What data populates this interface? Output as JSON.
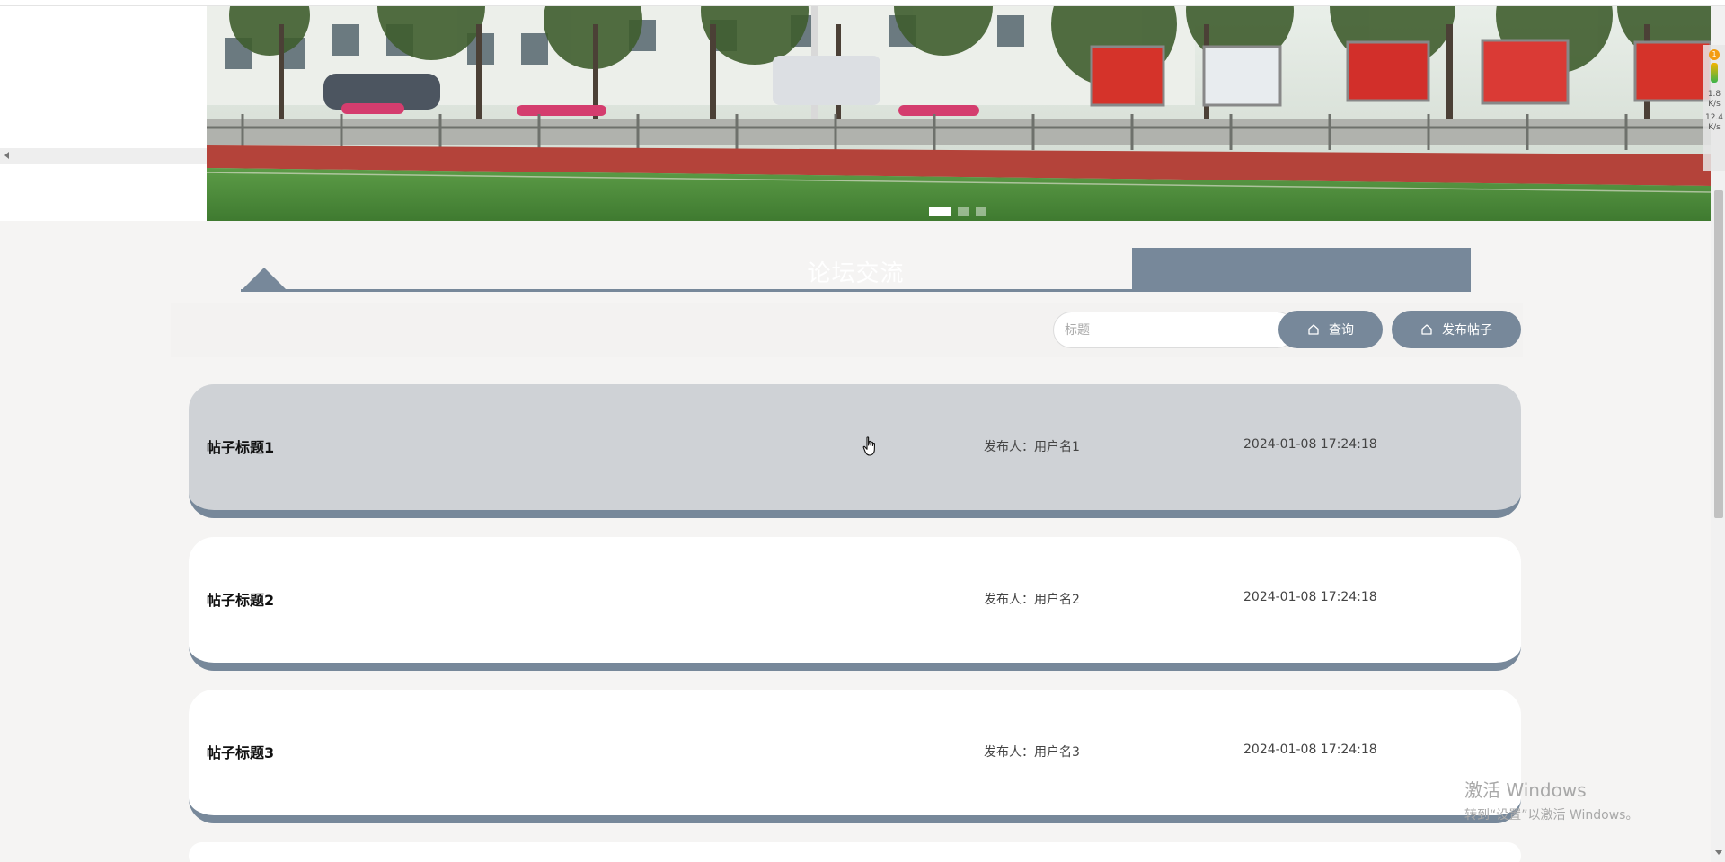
{
  "banner": {
    "slide_count": 3,
    "active_index": 0
  },
  "section": {
    "title": "论坛交流"
  },
  "search": {
    "placeholder": "标题",
    "query_label": "查询",
    "post_label": "发布帖子"
  },
  "posts": [
    {
      "title": "帖子标题1",
      "author_label": "发布人：",
      "author": "用户名1",
      "time": "2024-01-08 17:24:18"
    },
    {
      "title": "帖子标题2",
      "author_label": "发布人：",
      "author": "用户名2",
      "time": "2024-01-08 17:24:18"
    },
    {
      "title": "帖子标题3",
      "author_label": "发布人：",
      "author": "用户名3",
      "time": "2024-01-08 17:24:18"
    }
  ],
  "net_widget": {
    "badge": "1",
    "up": "1.8",
    "up_unit": "K/s",
    "down": "12.4",
    "down_unit": "K/s"
  },
  "watermark": {
    "title": "激活 Windows",
    "subtitle": "转到“设置”以激活 Windows。"
  },
  "colors": {
    "accent": "#77889a",
    "page_bg": "#f5f4f3",
    "hover_card": "#cfd2d6"
  }
}
